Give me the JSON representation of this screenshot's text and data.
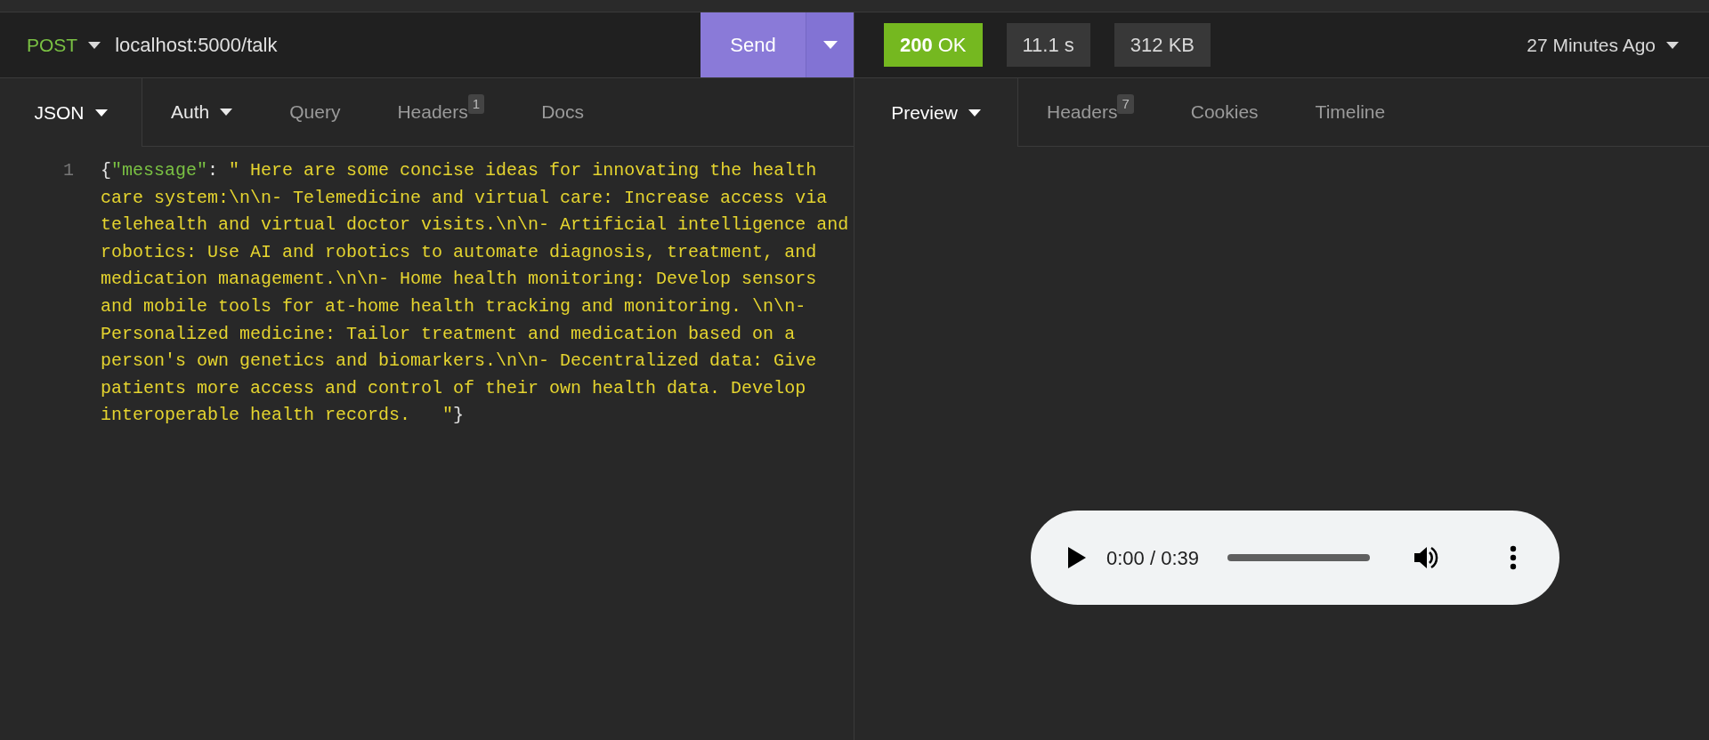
{
  "request": {
    "method": "POST",
    "url": "localhost:5000/talk",
    "send_label": "Send"
  },
  "request_tabs": [
    {
      "label": "JSON",
      "selected": true,
      "dropdown": true
    },
    {
      "label": "Auth",
      "selected": false,
      "dropdown": true
    },
    {
      "label": "Query",
      "selected": false
    },
    {
      "label": "Headers",
      "selected": false,
      "badge": "1"
    },
    {
      "label": "Docs",
      "selected": false
    }
  ],
  "editor": {
    "lines": [
      {
        "number": "1",
        "segments": [
          {
            "kind": "punct",
            "text": "{"
          },
          {
            "kind": "key",
            "text": "\"message\""
          },
          {
            "kind": "punct",
            "text": ": "
          },
          {
            "kind": "string",
            "text": "\" Here are some concise ideas for innovating the health"
          }
        ]
      },
      {
        "segments": [
          {
            "kind": "string",
            "text": "care system:\\n\\n- Telemedicine and virtual care: Increase access via"
          }
        ]
      },
      {
        "segments": [
          {
            "kind": "string",
            "text": "telehealth and virtual doctor visits.\\n\\n- Artificial intelligence and"
          }
        ]
      },
      {
        "segments": [
          {
            "kind": "string",
            "text": "robotics: Use AI and robotics to automate diagnosis, treatment, and"
          }
        ]
      },
      {
        "segments": [
          {
            "kind": "string",
            "text": "medication management.\\n\\n- Home health monitoring: Develop sensors"
          }
        ]
      },
      {
        "segments": [
          {
            "kind": "string",
            "text": "and mobile tools for at-home health tracking and monitoring. \\n\\n-"
          }
        ]
      },
      {
        "segments": [
          {
            "kind": "string",
            "text": "Personalized medicine: Tailor treatment and medication based on a"
          }
        ]
      },
      {
        "segments": [
          {
            "kind": "string",
            "text": "person's own genetics and biomarkers.\\n\\n- Decentralized data: Give"
          }
        ]
      },
      {
        "segments": [
          {
            "kind": "string",
            "text": "patients more access and control of their own health data. Develop"
          }
        ]
      },
      {
        "segments": [
          {
            "kind": "string",
            "text": "interoperable health records.   \""
          },
          {
            "kind": "punct",
            "text": "}"
          }
        ]
      }
    ]
  },
  "response": {
    "status_code": "200",
    "status_text": "OK",
    "time": "11.1 s",
    "size": "312 KB",
    "history": "27 Minutes Ago"
  },
  "response_tabs": [
    {
      "label": "Preview",
      "selected": true,
      "dropdown": true
    },
    {
      "label": "Headers",
      "selected": false,
      "badge": "7"
    },
    {
      "label": "Cookies",
      "selected": false
    },
    {
      "label": "Timeline",
      "selected": false
    }
  ],
  "audio_player": {
    "time": "0:00 / 0:39",
    "level": 0
  }
}
